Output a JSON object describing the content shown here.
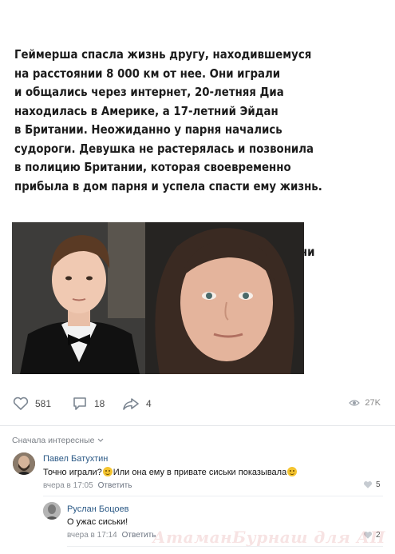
{
  "post": {
    "paragraphs": [
      "Геймерша спасла жизнь другу, находившемуся\nна расстоянии 8 000 км от нее. Они играли\nи общались через интернет, 20-летняя Диа\nнаходилась в Америке, а 17-летний Эйдан\nв Британии. Неожиданно у парня начались\nсудороги. Девушка не растерялась и позвонила\nв полицию Британии, которая своевременно\nприбыла в дом парня и успела спасти ему жизнь.",
      "Родители парня всё это время были дома, но ни\nо чём не подозревали, так как он не мог даже\nпозвать на помощь."
    ]
  },
  "actions": {
    "likes": "581",
    "comments": "18",
    "shares": "4",
    "views": "27K"
  },
  "comments_sort": "Сначала интересные",
  "comments": [
    {
      "author": "Павел Батухтин",
      "text_before": "Точно играли?",
      "text_middle": "Или она ему в привате сиськи показывала",
      "time": "вчера в 17:05",
      "reply": "Ответить",
      "likes": "5"
    },
    {
      "author": "Руслан Боцоев",
      "text": "О ужас сиськи!",
      "time": "вчера в 17:14",
      "reply": "Ответить",
      "likes": "2"
    }
  ],
  "watermark": "АтаманБурнаш для АП",
  "colors": {
    "link": "#2a5885",
    "accent": "#4a76a8"
  }
}
